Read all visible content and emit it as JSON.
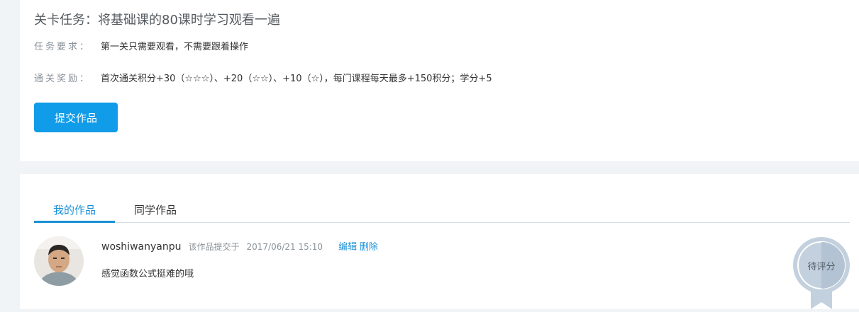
{
  "task": {
    "title": "关卡任务：将基础课的80课时学习观看一遍",
    "requirement_label": "任务要求：",
    "requirement_value": "第一关只需要观看，不需要跟着操作",
    "reward_label": "通关奖励：",
    "reward_value": "首次通关积分+30（☆☆☆）、+20（☆☆）、+10（☆），每门课程每天最多+150积分；学分+5",
    "submit_label": "提交作品"
  },
  "works": {
    "tabs": [
      {
        "label": "我的作品",
        "active": true
      },
      {
        "label": "同学作品",
        "active": false
      }
    ],
    "items": [
      {
        "username": "woshiwanyanpu",
        "submitted_label": "该作品提交于",
        "date": "2017/06/21 15:10",
        "edit_label": "编辑",
        "delete_label": "删除",
        "comment": "感觉函数公式挺难的哦",
        "status_badge": "待评分"
      }
    ]
  },
  "colors": {
    "accent": "#109ce8",
    "link": "#1a8fd8",
    "page_bg": "#f0f4f7",
    "badge": "#c3d0de"
  }
}
